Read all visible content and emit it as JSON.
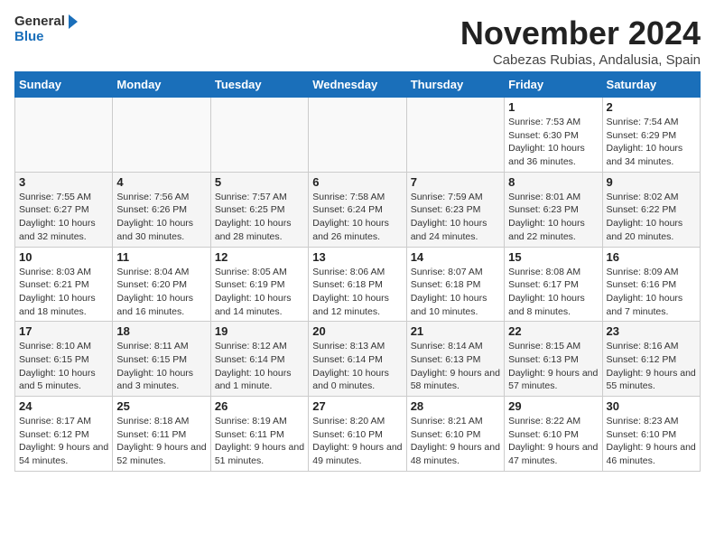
{
  "header": {
    "logo_general": "General",
    "logo_blue": "Blue",
    "month_title": "November 2024",
    "subtitle": "Cabezas Rubias, Andalusia, Spain"
  },
  "weekdays": [
    "Sunday",
    "Monday",
    "Tuesday",
    "Wednesday",
    "Thursday",
    "Friday",
    "Saturday"
  ],
  "weeks": [
    [
      {
        "day": "",
        "info": ""
      },
      {
        "day": "",
        "info": ""
      },
      {
        "day": "",
        "info": ""
      },
      {
        "day": "",
        "info": ""
      },
      {
        "day": "",
        "info": ""
      },
      {
        "day": "1",
        "info": "Sunrise: 7:53 AM\nSunset: 6:30 PM\nDaylight: 10 hours and 36 minutes."
      },
      {
        "day": "2",
        "info": "Sunrise: 7:54 AM\nSunset: 6:29 PM\nDaylight: 10 hours and 34 minutes."
      }
    ],
    [
      {
        "day": "3",
        "info": "Sunrise: 7:55 AM\nSunset: 6:27 PM\nDaylight: 10 hours and 32 minutes."
      },
      {
        "day": "4",
        "info": "Sunrise: 7:56 AM\nSunset: 6:26 PM\nDaylight: 10 hours and 30 minutes."
      },
      {
        "day": "5",
        "info": "Sunrise: 7:57 AM\nSunset: 6:25 PM\nDaylight: 10 hours and 28 minutes."
      },
      {
        "day": "6",
        "info": "Sunrise: 7:58 AM\nSunset: 6:24 PM\nDaylight: 10 hours and 26 minutes."
      },
      {
        "day": "7",
        "info": "Sunrise: 7:59 AM\nSunset: 6:23 PM\nDaylight: 10 hours and 24 minutes."
      },
      {
        "day": "8",
        "info": "Sunrise: 8:01 AM\nSunset: 6:23 PM\nDaylight: 10 hours and 22 minutes."
      },
      {
        "day": "9",
        "info": "Sunrise: 8:02 AM\nSunset: 6:22 PM\nDaylight: 10 hours and 20 minutes."
      }
    ],
    [
      {
        "day": "10",
        "info": "Sunrise: 8:03 AM\nSunset: 6:21 PM\nDaylight: 10 hours and 18 minutes."
      },
      {
        "day": "11",
        "info": "Sunrise: 8:04 AM\nSunset: 6:20 PM\nDaylight: 10 hours and 16 minutes."
      },
      {
        "day": "12",
        "info": "Sunrise: 8:05 AM\nSunset: 6:19 PM\nDaylight: 10 hours and 14 minutes."
      },
      {
        "day": "13",
        "info": "Sunrise: 8:06 AM\nSunset: 6:18 PM\nDaylight: 10 hours and 12 minutes."
      },
      {
        "day": "14",
        "info": "Sunrise: 8:07 AM\nSunset: 6:18 PM\nDaylight: 10 hours and 10 minutes."
      },
      {
        "day": "15",
        "info": "Sunrise: 8:08 AM\nSunset: 6:17 PM\nDaylight: 10 hours and 8 minutes."
      },
      {
        "day": "16",
        "info": "Sunrise: 8:09 AM\nSunset: 6:16 PM\nDaylight: 10 hours and 7 minutes."
      }
    ],
    [
      {
        "day": "17",
        "info": "Sunrise: 8:10 AM\nSunset: 6:15 PM\nDaylight: 10 hours and 5 minutes."
      },
      {
        "day": "18",
        "info": "Sunrise: 8:11 AM\nSunset: 6:15 PM\nDaylight: 10 hours and 3 minutes."
      },
      {
        "day": "19",
        "info": "Sunrise: 8:12 AM\nSunset: 6:14 PM\nDaylight: 10 hours and 1 minute."
      },
      {
        "day": "20",
        "info": "Sunrise: 8:13 AM\nSunset: 6:14 PM\nDaylight: 10 hours and 0 minutes."
      },
      {
        "day": "21",
        "info": "Sunrise: 8:14 AM\nSunset: 6:13 PM\nDaylight: 9 hours and 58 minutes."
      },
      {
        "day": "22",
        "info": "Sunrise: 8:15 AM\nSunset: 6:13 PM\nDaylight: 9 hours and 57 minutes."
      },
      {
        "day": "23",
        "info": "Sunrise: 8:16 AM\nSunset: 6:12 PM\nDaylight: 9 hours and 55 minutes."
      }
    ],
    [
      {
        "day": "24",
        "info": "Sunrise: 8:17 AM\nSunset: 6:12 PM\nDaylight: 9 hours and 54 minutes."
      },
      {
        "day": "25",
        "info": "Sunrise: 8:18 AM\nSunset: 6:11 PM\nDaylight: 9 hours and 52 minutes."
      },
      {
        "day": "26",
        "info": "Sunrise: 8:19 AM\nSunset: 6:11 PM\nDaylight: 9 hours and 51 minutes."
      },
      {
        "day": "27",
        "info": "Sunrise: 8:20 AM\nSunset: 6:10 PM\nDaylight: 9 hours and 49 minutes."
      },
      {
        "day": "28",
        "info": "Sunrise: 8:21 AM\nSunset: 6:10 PM\nDaylight: 9 hours and 48 minutes."
      },
      {
        "day": "29",
        "info": "Sunrise: 8:22 AM\nSunset: 6:10 PM\nDaylight: 9 hours and 47 minutes."
      },
      {
        "day": "30",
        "info": "Sunrise: 8:23 AM\nSunset: 6:10 PM\nDaylight: 9 hours and 46 minutes."
      }
    ]
  ]
}
